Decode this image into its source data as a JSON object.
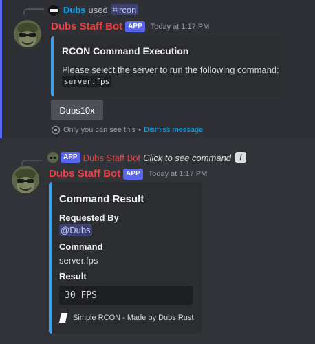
{
  "reply_header": {
    "user_name": "Dubs",
    "used_text": "used",
    "command_name": "rcon",
    "command_hash": "⌗"
  },
  "message1": {
    "bot_name": "Dubs Staff Bot",
    "badge": "APP",
    "timestamp": "Today at 1:17 PM",
    "embed": {
      "title": "RCON Command Execution",
      "description": "Please select the server to run the following command:",
      "code": "server.fps",
      "accent_color": "#3ba1f0"
    },
    "button_label": "Dubs10x",
    "ephemeral_text": "Only you can see this",
    "separator": "•",
    "dismiss_label": "Dismiss message"
  },
  "interaction_header": {
    "badge": "APP",
    "bot_name": "Dubs Staff Bot",
    "click_text": "Click to see command",
    "icon": "slash-command-icon"
  },
  "message2": {
    "bot_name": "Dubs Staff Bot",
    "badge": "APP",
    "timestamp": "Today at 1:17 PM",
    "embed": {
      "title": "Command Result",
      "fields": [
        {
          "name": "Requested By",
          "value": "@Dubs"
        },
        {
          "name": "Command",
          "value": "server.fps"
        },
        {
          "name": "Result",
          "value": "30 FPS"
        }
      ],
      "footer": "Simple RCON - Made by Dubs Rust",
      "accent_color": "#3ba1f0"
    }
  },
  "colors": {
    "blurple": "#5865f2",
    "bot_red": "#f23f42",
    "link_blue": "#00a8fc"
  }
}
